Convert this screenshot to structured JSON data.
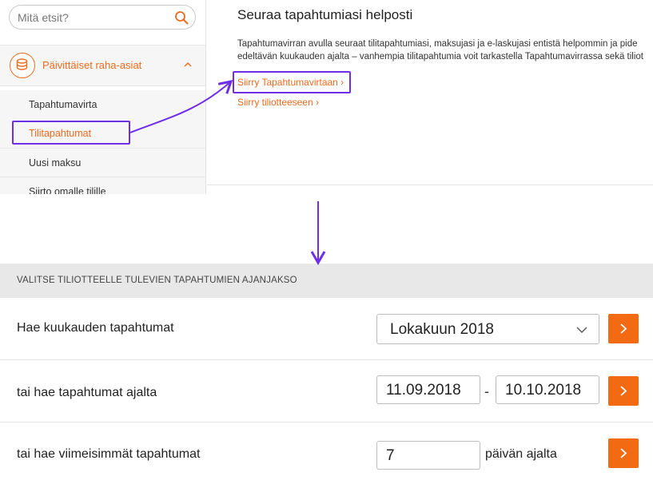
{
  "search": {
    "placeholder": "Mitä etsit?"
  },
  "sidebar": {
    "section_label": "Päivittäiset raha-asiat",
    "items": [
      {
        "label": "Tapahtumavirta"
      },
      {
        "label": "Tilitapahtumat"
      },
      {
        "label": "Uusi maksu"
      },
      {
        "label": "Siirto omalle tilille"
      }
    ]
  },
  "content": {
    "title": "Seuraa tapahtumiasi helposti",
    "text_line1": "Tapahtumavirran avulla seuraat tilitapahtumiasi, maksujasi ja e-laskujasi entistä helpommin ja pide",
    "text_line2": "edeltävän kuukauden ajalta – vanhempia tilitapahtumia voit tarkastella Tapahtumavirrassa sekä tiliot",
    "link1": "Siirry Tapahtumavirtaan ›",
    "link2": "Siirry tiliotteeseen ›"
  },
  "panel": {
    "header": "VALITSE TILIOTTEELLE TULEVIEN TAPAHTUMIEN AJANJAKSO",
    "row1": {
      "label": "Hae kuukauden tapahtumat",
      "select_value": "Lokakuun 2018"
    },
    "row2": {
      "label": "tai hae tapahtumat ajalta",
      "from": "11.09.2018",
      "separator": "-",
      "to": "10.10.2018"
    },
    "row3": {
      "label": "tai hae viimeisimmät tapahtumat",
      "days": "7",
      "suffix": "päivän ajalta"
    }
  },
  "colors": {
    "accent": "#ee6a1f",
    "button": "#f26a12",
    "annotation": "#6f2ee8"
  }
}
